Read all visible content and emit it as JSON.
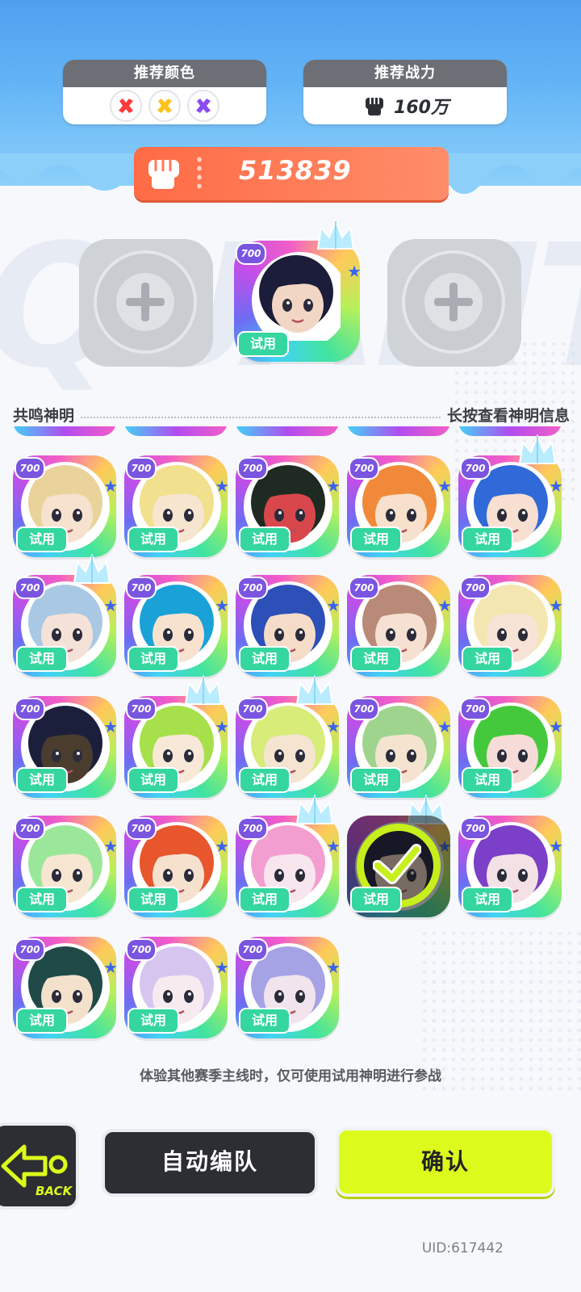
{
  "header": {
    "recommended_colors_title": "推荐颜色",
    "recommended_colors": [
      "#ff3b3b",
      "#ffc21a",
      "#8a4bf0"
    ],
    "recommended_power_title": "推荐战力",
    "recommended_power_value": "160万"
  },
  "team_power": "513839",
  "team_slots": [
    {
      "state": "empty",
      "icon": "plus-icon"
    },
    {
      "state": "filled",
      "level": "700",
      "tag": "试用",
      "hair": "#1b1d3a",
      "skin": "#f2d6c4",
      "crown": true
    },
    {
      "state": "empty",
      "icon": "plus-icon"
    }
  ],
  "section": {
    "title": "共鸣神明",
    "hint": "长按查看神明信息"
  },
  "roster": [
    {
      "level": "700",
      "tag": "试用",
      "hair": "#e9d39a",
      "skin": "#f6e2cf",
      "crown": false,
      "selected": false
    },
    {
      "level": "700",
      "tag": "试用",
      "hair": "#f1e08d",
      "skin": "#f7e6cf",
      "crown": false,
      "selected": false
    },
    {
      "level": "700",
      "tag": "试用",
      "hair": "#1f2b22",
      "skin": "#d8474c",
      "crown": false,
      "selected": false
    },
    {
      "level": "700",
      "tag": "试用",
      "hair": "#f08a3a",
      "skin": "#f7e0cc",
      "crown": false,
      "selected": false
    },
    {
      "level": "700",
      "tag": "试用",
      "hair": "#2f6ad8",
      "skin": "#f7dfd2",
      "crown": true,
      "selected": false
    },
    {
      "level": "700",
      "tag": "试用",
      "hair": "#a9c8e4",
      "skin": "#f4e2d8",
      "crown": true,
      "selected": false
    },
    {
      "level": "700",
      "tag": "试用",
      "hair": "#1aa2d8",
      "skin": "#f7e2d0",
      "crown": false,
      "selected": false
    },
    {
      "level": "700",
      "tag": "试用",
      "hair": "#2c4fb8",
      "skin": "#f4dcc8",
      "crown": false,
      "selected": false
    },
    {
      "level": "700",
      "tag": "试用",
      "hair": "#b98a78",
      "skin": "#f6e0d2",
      "crown": false,
      "selected": false
    },
    {
      "level": "700",
      "tag": "试用",
      "hair": "#f3e6b0",
      "skin": "#f7e4d6",
      "crown": false,
      "selected": false
    },
    {
      "level": "700",
      "tag": "试用",
      "hair": "#1c1f3c",
      "skin": "#4a3d2e",
      "crown": false,
      "selected": false
    },
    {
      "level": "700",
      "tag": "试用",
      "hair": "#a6e04a",
      "skin": "#f7e8d8",
      "crown": true,
      "selected": false
    },
    {
      "level": "700",
      "tag": "试用",
      "hair": "#d8ec7a",
      "skin": "#f5e4d0",
      "crown": true,
      "selected": false
    },
    {
      "level": "700",
      "tag": "试用",
      "hair": "#9fd48e",
      "skin": "#f4e4cf",
      "crown": false,
      "selected": false
    },
    {
      "level": "700",
      "tag": "试用",
      "hair": "#45c93c",
      "skin": "#f6dcd8",
      "crown": false,
      "selected": false
    },
    {
      "level": "700",
      "tag": "试用",
      "hair": "#9be79a",
      "skin": "#f7e6d2",
      "crown": false,
      "selected": false
    },
    {
      "level": "700",
      "tag": "试用",
      "hair": "#e8562e",
      "skin": "#f6e1cf",
      "crown": false,
      "selected": false
    },
    {
      "level": "700",
      "tag": "试用",
      "hair": "#f39ed0",
      "skin": "#f8e6ee",
      "crown": true,
      "selected": false
    },
    {
      "level": "",
      "tag": "试用",
      "hair": "#1b1d3a",
      "skin": "#f2d6c4",
      "crown": true,
      "selected": true
    },
    {
      "level": "700",
      "tag": "试用",
      "hair": "#7b3fc8",
      "skin": "#f3e1e6",
      "crown": false,
      "selected": false
    },
    {
      "level": "700",
      "tag": "试用",
      "hair": "#1f4a48",
      "skin": "#f4e1cc",
      "crown": false,
      "selected": false
    },
    {
      "level": "700",
      "tag": "试用",
      "hair": "#d6c6ef",
      "skin": "#f7ebef",
      "crown": false,
      "selected": false
    },
    {
      "level": "700",
      "tag": "试用",
      "hair": "#a5a2e6",
      "skin": "#f1e4ec",
      "crown": false,
      "selected": false
    }
  ],
  "notice": "体验其他赛季主线时，仅可使用试用神明进行参战",
  "buttons": {
    "back_label": "BACK",
    "auto_label": "自动编队",
    "confirm_label": "确认"
  },
  "uid": "UID:617442"
}
